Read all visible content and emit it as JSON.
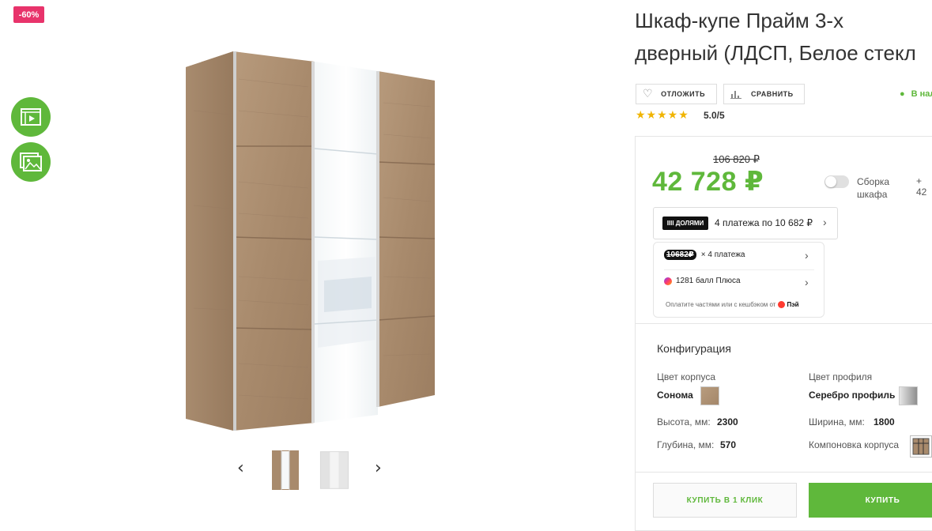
{
  "badge": "-60%",
  "product": {
    "title_line1": "Шкаф-купе Прайм 3-х",
    "title_line2": "дверный (ЛДСП, Белое стекл"
  },
  "actions": {
    "postpone_label": "ОТЛОЖИТЬ",
    "compare_label": "СРАВНИТЬ",
    "availability": "В нал"
  },
  "rating": {
    "stars": "★★★★★",
    "value": "5.0/5"
  },
  "price": {
    "old": "106 820 ₽",
    "current": "42 728 ₽"
  },
  "assembly": {
    "label_line1": "Сборка",
    "label_line2": "шкафа",
    "extra": "+ 42"
  },
  "dolyami": {
    "logo": "IIII ДОЛЯМИ",
    "text": "4 платежа по 10 682 ₽"
  },
  "split": {
    "amount": "10682₽",
    "payments": "× 4 платежа",
    "plus_points": "1281 балл Плюса",
    "note": "Оплатите частями или с кешбэком от",
    "pay_brand": "Пэй"
  },
  "config": {
    "title": "Конфигурация",
    "body_color_label": "Цвет корпуса",
    "body_color_value": "Сонома",
    "profile_color_label": "Цвет профиля",
    "profile_color_value": "Серебро профиль",
    "height_label": "Высота, мм:",
    "height_value": "2300",
    "width_label": "Ширина, мм:",
    "width_value": "1800",
    "depth_label": "Глубина, мм:",
    "depth_value": "570",
    "layout_label": "Компоновка корпуса"
  },
  "buttons": {
    "buy_one_click": "КУПИТЬ В 1 КЛИК",
    "buy": "КУПИТЬ"
  },
  "gallery": {
    "prev": "‹",
    "next": "›"
  },
  "colors": {
    "accent": "#5fb83b",
    "badge": "#e8336b",
    "stars": "#f0b400"
  }
}
